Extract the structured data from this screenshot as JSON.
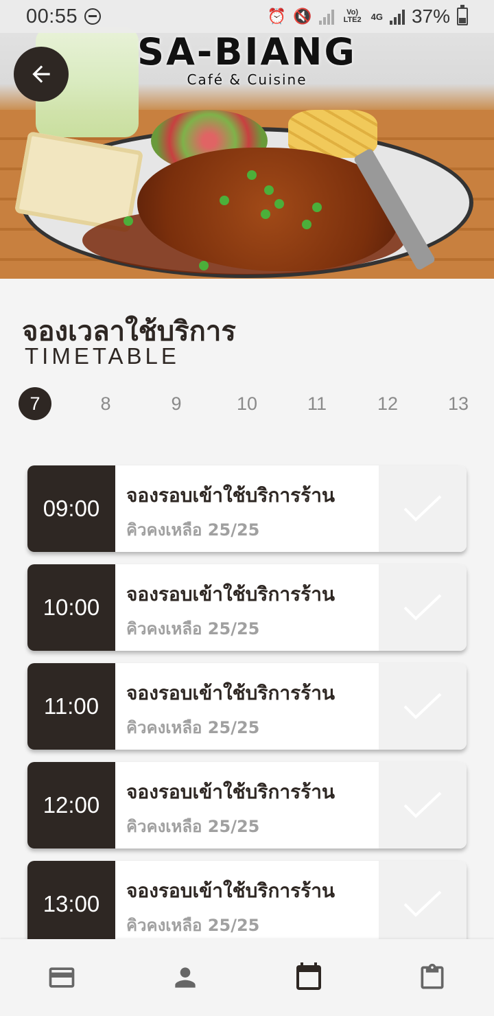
{
  "status_bar": {
    "time": "00:55",
    "network_label": "Vo) LTE2",
    "network_type": "4G",
    "battery_percent": "37%"
  },
  "header": {
    "brand": "SA-BIANG",
    "tagline": "Café & Cuisine",
    "back_icon": "arrow-left-icon"
  },
  "page": {
    "title_th": "จองเวลาใช้บริการ",
    "title_en": "TIMETABLE"
  },
  "dates": {
    "selected": "7",
    "items": [
      "7",
      "8",
      "9",
      "10",
      "11",
      "12",
      "13"
    ]
  },
  "slots": [
    {
      "time": "09:00",
      "label": "จองรอบเข้าใช้บริการร้าน",
      "remaining": "คิวคงเหลือ 25/25"
    },
    {
      "time": "10:00",
      "label": "จองรอบเข้าใช้บริการร้าน",
      "remaining": "คิวคงเหลือ 25/25"
    },
    {
      "time": "11:00",
      "label": "จองรอบเข้าใช้บริการร้าน",
      "remaining": "คิวคงเหลือ 25/25"
    },
    {
      "time": "12:00",
      "label": "จองรอบเข้าใช้บริการร้าน",
      "remaining": "คิวคงเหลือ 25/25"
    },
    {
      "time": "13:00",
      "label": "จองรอบเข้าใช้บริการร้าน",
      "remaining": "คิวคงเหลือ 25/25"
    }
  ],
  "bottom_nav": {
    "items": [
      {
        "icon": "credit-card-icon"
      },
      {
        "icon": "person-icon"
      },
      {
        "icon": "calendar-icon",
        "active": true
      },
      {
        "icon": "clipboard-icon"
      }
    ]
  },
  "colors": {
    "primary_dark": "#2e2723",
    "background": "#f4f4f4",
    "muted_text": "#a0a0a0",
    "inactive_icon": "#666666"
  }
}
